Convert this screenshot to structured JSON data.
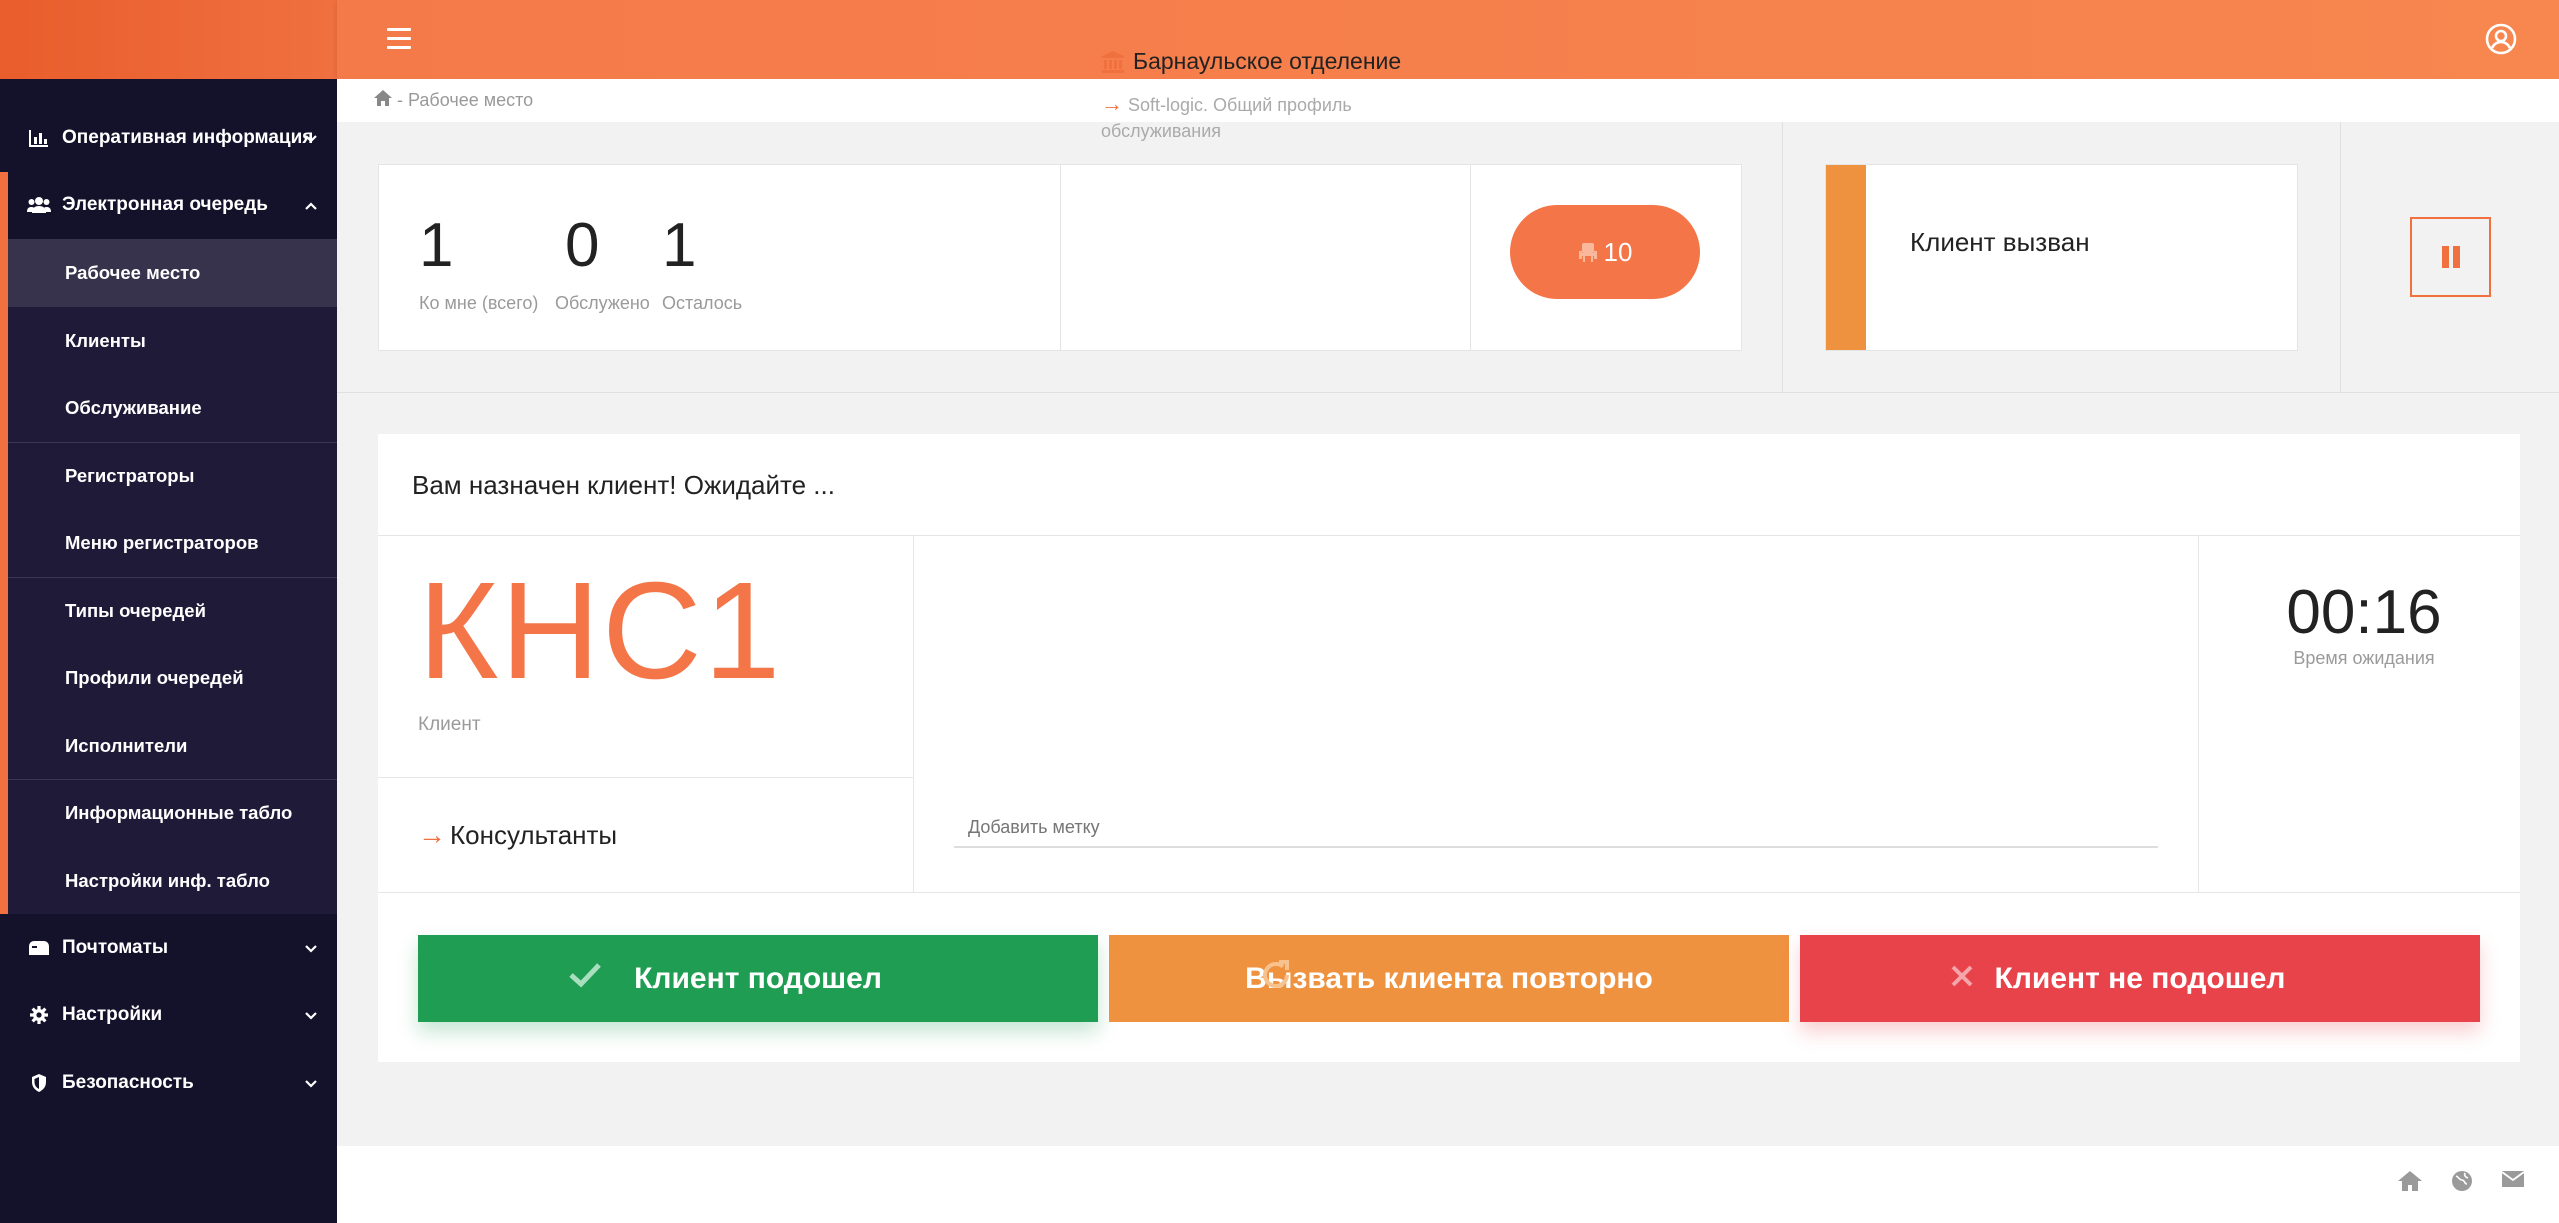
{
  "header": {
    "menu_icon": "hamburger-icon",
    "user_icon": "user-circle-icon"
  },
  "breadcrumb": {
    "text": "- Рабочее место"
  },
  "sidebar": {
    "items": [
      {
        "label": "Оперативная информация",
        "icon": "chart-icon"
      },
      {
        "label": "Электронная очередь",
        "icon": "users-icon"
      },
      {
        "label": "Почтоматы",
        "icon": "mailbox-icon"
      },
      {
        "label": "Настройки",
        "icon": "gear-icon"
      },
      {
        "label": "Безопасность",
        "icon": "shield-icon"
      }
    ],
    "subitems": [
      "Рабочее место",
      "Клиенты",
      "Обслуживание",
      "Регистраторы",
      "Меню регистраторов",
      "Типы очередей",
      "Профили очередей",
      "Исполнители",
      "Информационные табло",
      "Настройки инф. табло"
    ]
  },
  "stats": [
    {
      "value": "1",
      "label": "Ко мне (всего)"
    },
    {
      "value": "0",
      "label": "Обслужено"
    },
    {
      "value": "1",
      "label": "Осталось"
    }
  ],
  "branch": {
    "title": "Барнаульское отделение",
    "profile": "Soft-logic. Общий профиль обслуживания"
  },
  "seat_button": {
    "label": "10"
  },
  "status": {
    "text": "Клиент вызван"
  },
  "main": {
    "assigned_text": "Вам назначен клиент! Ожидайте ...",
    "ticket": "КНС1",
    "ticket_label": "Клиент",
    "consultants": "Консультанты",
    "tag_placeholder": "Добавить метку",
    "timer": "00:16",
    "timer_label": "Время ожидания"
  },
  "actions": {
    "arrived": "Клиент подошел",
    "recall": "Вызвать клиента повторно",
    "not_arrived": "Клиент не подошел"
  },
  "colors": {
    "accent": "#f47548",
    "green": "#1f9d52",
    "orange": "#ef9240",
    "red": "#e8434a",
    "sidebar": "#14112a"
  }
}
